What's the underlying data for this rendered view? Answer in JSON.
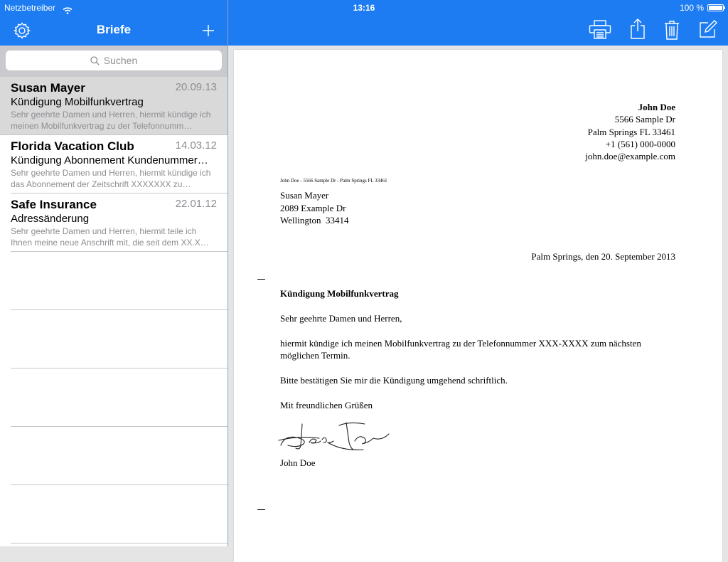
{
  "status": {
    "carrier": "Netzbetreiber",
    "time": "13:16",
    "battery": "100 %"
  },
  "sidebar": {
    "title": "Briefe",
    "search_placeholder": "Suchen",
    "items": [
      {
        "name": "Susan Mayer",
        "date": "20.09.13",
        "subject": "Kündigung Mobilfunkvertrag",
        "preview": "Sehr geehrte Damen und Herren,  hiermit kündige ich meinen Mobilfunkvertrag zu der Telefonnumm…",
        "selected": true
      },
      {
        "name": "Florida Vacation Club",
        "date": "14.03.12",
        "subject": "Kündigung Abonnement Kundenummer…",
        "preview": "Sehr geehrte Damen und Herren,  hiermit kündige ich das Abonnement der Zeitschrift XXXXXXX zu…",
        "selected": false
      },
      {
        "name": "Safe Insurance",
        "date": "22.01.12",
        "subject": "Adressänderung",
        "preview": "Sehr geehrte Damen und Herren,  hiermit teile ich Ihnen meine neue Anschrift mit, die seit dem XX.X…",
        "selected": false
      }
    ]
  },
  "toolbar": {
    "icons": [
      "gear-icon",
      "plus-icon",
      "printer-icon",
      "share-icon",
      "trash-icon",
      "compose-icon"
    ]
  },
  "letter": {
    "sender": {
      "name": "John Doe",
      "street": "5566 Sample Dr",
      "city": "Palm Springs FL 33461",
      "phone": "+1 (561) 000-0000",
      "email": "john.doe@example.com"
    },
    "return_line": "John Doe - 5566 Sample Dr - Palm Springs FL 33461",
    "recipient": {
      "name": "Susan Mayer",
      "street": "2089 Example Dr",
      "city": "Wellington  33414"
    },
    "place_date": "Palm Springs, den 20. September 2013",
    "subject": "Kündigung Mobilfunkvertrag",
    "salutation": "Sehr geehrte Damen und Herren,",
    "body1": "hiermit kündige ich meinen Mobilfunkvertrag zu der Telefonnummer XXX-XXXX zum nächsten möglichen Termin.",
    "body2": "Bitte bestätigen Sie mir die Kündigung umgehend schriftlich.",
    "closing": "Mit freundlichen Grüßen",
    "signature_name": "John Doe"
  },
  "colors": {
    "accent": "#1d7cf2",
    "selected_row": "#d9d9d9",
    "secondary_text": "#8e8e93"
  }
}
